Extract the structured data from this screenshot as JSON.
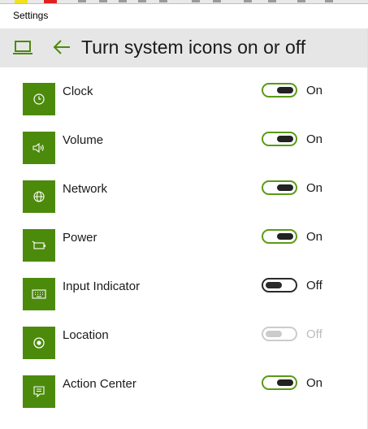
{
  "window": {
    "title": "Settings"
  },
  "header": {
    "title": "Turn system icons on or off",
    "device_icon": "laptop-icon",
    "back_icon": "back-arrow-icon"
  },
  "colors": {
    "accent": "#4c8a0c",
    "toggle_on_border": "#5a9a16",
    "header_bg": "#e6e6e6"
  },
  "items": [
    {
      "label": "Clock",
      "icon": "clock-icon",
      "state": "On",
      "on": true,
      "enabled": true
    },
    {
      "label": "Volume",
      "icon": "volume-icon",
      "state": "On",
      "on": true,
      "enabled": true
    },
    {
      "label": "Network",
      "icon": "network-globe-icon",
      "state": "On",
      "on": true,
      "enabled": true
    },
    {
      "label": "Power",
      "icon": "battery-power-icon",
      "state": "On",
      "on": true,
      "enabled": true
    },
    {
      "label": "Input Indicator",
      "icon": "keyboard-icon",
      "state": "Off",
      "on": false,
      "enabled": true
    },
    {
      "label": "Location",
      "icon": "location-icon",
      "state": "Off",
      "on": false,
      "enabled": false
    },
    {
      "label": "Action Center",
      "icon": "action-center-icon",
      "state": "On",
      "on": true,
      "enabled": true
    }
  ]
}
